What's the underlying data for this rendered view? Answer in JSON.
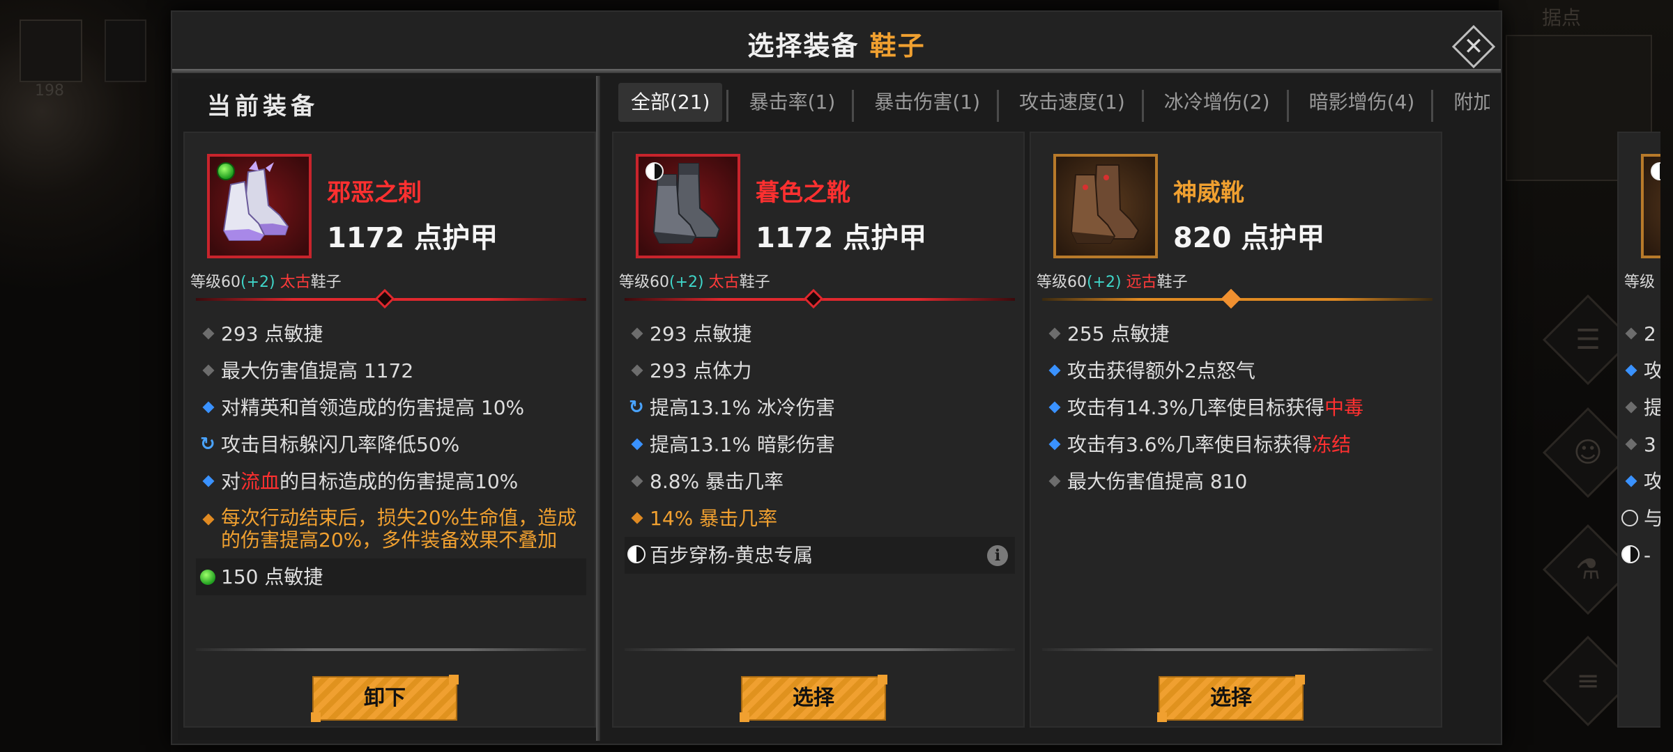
{
  "background": {
    "slot_count": "198",
    "top_right_label": "据点"
  },
  "window": {
    "title_prefix": "选择装备",
    "title_accent": "鞋子",
    "close_label": "✕"
  },
  "current": {
    "section_title": "当前装备",
    "item": {
      "name": "邪恶之刺",
      "armor": "1172 点护甲",
      "level_prefix": "等级60",
      "level_bonus": "(+2)",
      "tier": "太古",
      "slot": "鞋子",
      "stats": [
        "293 点敏捷",
        "最大伤害值提高 1172",
        "对精英和首领造成的伤害提高 10%",
        "攻击目标躲闪几率降低50%"
      ],
      "stat5_pre": "对",
      "stat5_red": "流血",
      "stat5_post": "的目标造成的伤害提高10%",
      "legendary": "每次行动结束后，损失20%生命值，造成的伤害提高20%，多件装备效果不叠加",
      "socket": "150 点敏捷",
      "button": "卸下"
    }
  },
  "tabs": [
    "全部(21)",
    "暴击率(1)",
    "暴击伤害(1)",
    "攻击速度(1)",
    "冰冷增伤(2)",
    "暗影增伤(4)",
    "附加异常("
  ],
  "cards": [
    {
      "name": "暮色之靴",
      "armor": "1172 点护甲",
      "level_prefix": "等级60",
      "level_bonus": "(+2)",
      "tier": "太古",
      "slot": "鞋子",
      "stats": [
        "293 点敏捷",
        "293 点体力",
        "提高13.1% 冰冷伤害",
        "提高13.1% 暗影伤害",
        "8.8% 暴击几率"
      ],
      "legendary": "14% 暴击几率",
      "set": "百步穿杨-黄忠专属",
      "info": "i",
      "button": "选择"
    },
    {
      "name": "神威靴",
      "armor": "820 点护甲",
      "level_prefix": "等级60",
      "level_bonus": "(+2)",
      "tier": "远古",
      "slot": "鞋子",
      "stats": [
        "255 点敏捷",
        "攻击获得额外2点怒气"
      ],
      "stat3_pre": "攻击有14.3%几率使目标获得",
      "stat3_red": "中毒",
      "stat4_pre": "攻击有3.6%几率使目标获得",
      "stat4_red": "冻结",
      "stat5": "最大伤害值提高 810",
      "button": "选择"
    },
    {
      "level_prefix": "等级",
      "stats": [
        "2",
        "攻",
        "提",
        "3",
        "攻",
        "与",
        "-"
      ]
    }
  ],
  "colors": {
    "accent_orange": "#f0a030",
    "rarity_red": "#e0282e",
    "bonus_cyan": "#3fd5c8",
    "magic_blue": "#3a92ff"
  }
}
